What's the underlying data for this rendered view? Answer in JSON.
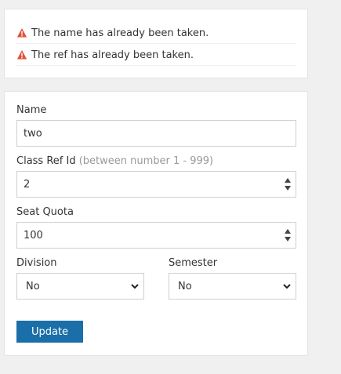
{
  "errors": [
    {
      "message": "The name has already been taken."
    },
    {
      "message": "The ref has already been taken."
    }
  ],
  "form": {
    "name_label": "Name",
    "name_value": "two",
    "class_ref_label": "Class Ref Id",
    "class_ref_hint": "(between number 1 - 999)",
    "class_ref_value": "2",
    "seat_quota_label": "Seat Quota",
    "seat_quota_value": "100",
    "division_label": "Division",
    "division_value": "No",
    "semester_label": "Semester",
    "semester_value": "No",
    "update_label": "Update"
  },
  "colors": {
    "error_icon": "#e0543c",
    "button": "#1a6fa8"
  }
}
